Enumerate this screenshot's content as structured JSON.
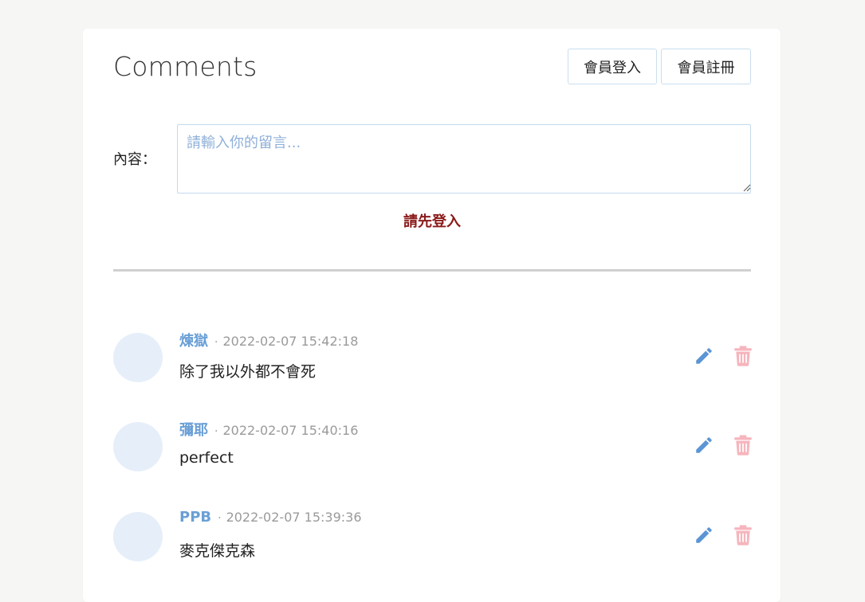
{
  "header": {
    "title": "Comments",
    "login_label": "會員登入",
    "register_label": "會員註冊"
  },
  "form": {
    "content_label": "內容：",
    "placeholder": "請輸入你的留言...",
    "value": "",
    "login_warning": "請先登入"
  },
  "comments": [
    {
      "author": "煉獄",
      "separator": "·",
      "timestamp": "2022-02-07 15:42:18",
      "content": "除了我以外都不會死",
      "edit_icon": "pencil-icon",
      "delete_icon": "trash-icon"
    },
    {
      "author": "彌耶",
      "separator": "·",
      "timestamp": "2022-02-07 15:40:16",
      "content": "perfect",
      "edit_icon": "pencil-icon",
      "delete_icon": "trash-icon"
    },
    {
      "author": "PPB",
      "separator": "·",
      "timestamp": "2022-02-07 15:39:36",
      "content": "麥克傑克森",
      "edit_icon": "pencil-icon",
      "delete_icon": "trash-icon"
    }
  ],
  "colors": {
    "background": "#f6f6f5",
    "card": "#ffffff",
    "author": "#6a9fd6",
    "warning": "#8b1a1a",
    "edit_icon": "#5b95d4",
    "delete_icon": "#f6b5bd",
    "avatar": "#e6eff9"
  }
}
